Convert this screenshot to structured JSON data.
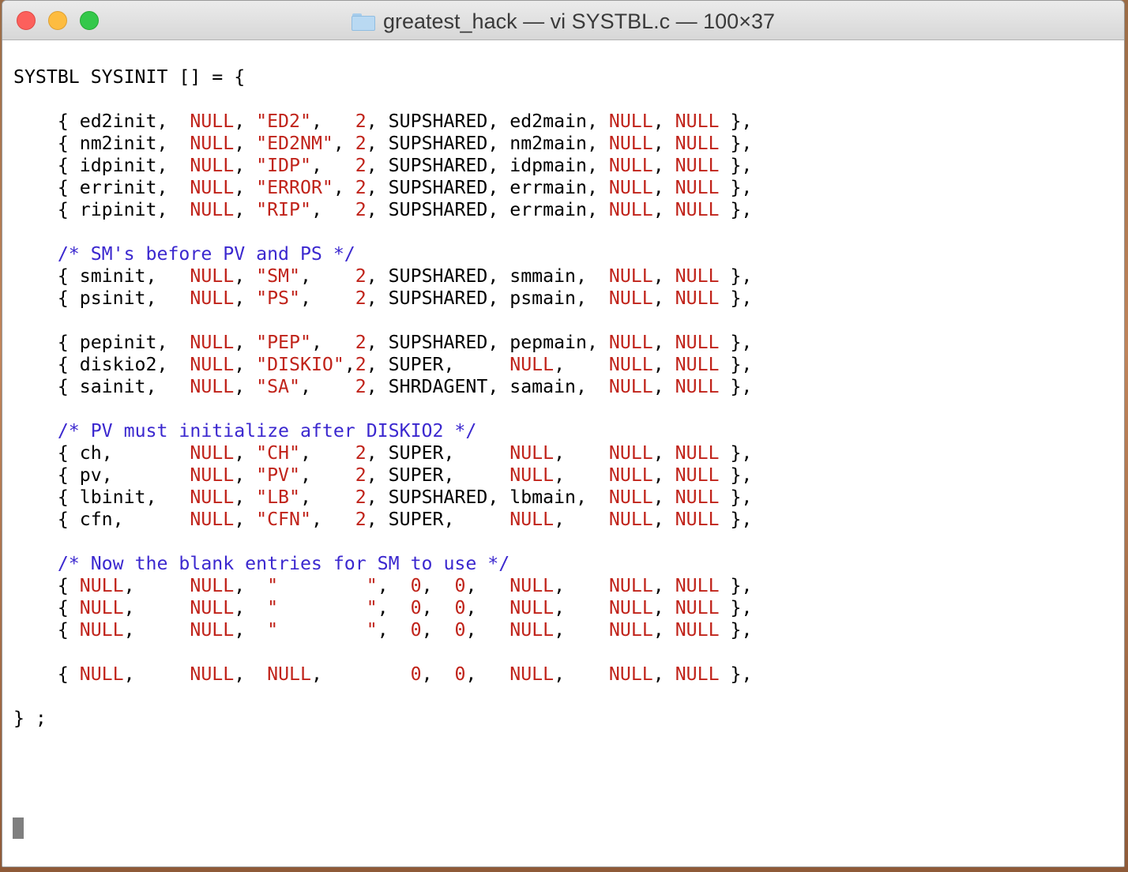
{
  "window": {
    "title": "greatest_hack — vi SYSTBL.c — 100×37",
    "folder_icon": "folder-icon"
  },
  "colors": {
    "keyword_red": "#c0231a",
    "comment_blue": "#3b28cf",
    "text": "#000000"
  },
  "code": {
    "lines": [
      [
        {
          "t": "SYSTBL SYSINIT [] = {",
          "c": ""
        }
      ],
      [
        {
          "t": "",
          "c": ""
        }
      ],
      [
        {
          "t": "    { ed2init,  ",
          "c": ""
        },
        {
          "t": "NULL",
          "c": "kw"
        },
        {
          "t": ", ",
          "c": ""
        },
        {
          "t": "\"ED2\"",
          "c": "kw"
        },
        {
          "t": ",   ",
          "c": ""
        },
        {
          "t": "2",
          "c": "kw"
        },
        {
          "t": ", SUPSHARED, ed2main, ",
          "c": ""
        },
        {
          "t": "NULL",
          "c": "kw"
        },
        {
          "t": ", ",
          "c": ""
        },
        {
          "t": "NULL",
          "c": "kw"
        },
        {
          "t": " },",
          "c": ""
        }
      ],
      [
        {
          "t": "    { nm2init,  ",
          "c": ""
        },
        {
          "t": "NULL",
          "c": "kw"
        },
        {
          "t": ", ",
          "c": ""
        },
        {
          "t": "\"ED2NM\"",
          "c": "kw"
        },
        {
          "t": ", ",
          "c": ""
        },
        {
          "t": "2",
          "c": "kw"
        },
        {
          "t": ", SUPSHARED, nm2main, ",
          "c": ""
        },
        {
          "t": "NULL",
          "c": "kw"
        },
        {
          "t": ", ",
          "c": ""
        },
        {
          "t": "NULL",
          "c": "kw"
        },
        {
          "t": " },",
          "c": ""
        }
      ],
      [
        {
          "t": "    { idpinit,  ",
          "c": ""
        },
        {
          "t": "NULL",
          "c": "kw"
        },
        {
          "t": ", ",
          "c": ""
        },
        {
          "t": "\"IDP\"",
          "c": "kw"
        },
        {
          "t": ",   ",
          "c": ""
        },
        {
          "t": "2",
          "c": "kw"
        },
        {
          "t": ", SUPSHARED, idpmain, ",
          "c": ""
        },
        {
          "t": "NULL",
          "c": "kw"
        },
        {
          "t": ", ",
          "c": ""
        },
        {
          "t": "NULL",
          "c": "kw"
        },
        {
          "t": " },",
          "c": ""
        }
      ],
      [
        {
          "t": "    { errinit,  ",
          "c": ""
        },
        {
          "t": "NULL",
          "c": "kw"
        },
        {
          "t": ", ",
          "c": ""
        },
        {
          "t": "\"ERROR\"",
          "c": "kw"
        },
        {
          "t": ", ",
          "c": ""
        },
        {
          "t": "2",
          "c": "kw"
        },
        {
          "t": ", SUPSHARED, errmain, ",
          "c": ""
        },
        {
          "t": "NULL",
          "c": "kw"
        },
        {
          "t": ", ",
          "c": ""
        },
        {
          "t": "NULL",
          "c": "kw"
        },
        {
          "t": " },",
          "c": ""
        }
      ],
      [
        {
          "t": "    { ripinit,  ",
          "c": ""
        },
        {
          "t": "NULL",
          "c": "kw"
        },
        {
          "t": ", ",
          "c": ""
        },
        {
          "t": "\"RIP\"",
          "c": "kw"
        },
        {
          "t": ",   ",
          "c": ""
        },
        {
          "t": "2",
          "c": "kw"
        },
        {
          "t": ", SUPSHARED, errmain, ",
          "c": ""
        },
        {
          "t": "NULL",
          "c": "kw"
        },
        {
          "t": ", ",
          "c": ""
        },
        {
          "t": "NULL",
          "c": "kw"
        },
        {
          "t": " },",
          "c": ""
        }
      ],
      [
        {
          "t": "",
          "c": ""
        }
      ],
      [
        {
          "t": "    ",
          "c": ""
        },
        {
          "t": "/* SM's before PV and PS */",
          "c": "cm"
        }
      ],
      [
        {
          "t": "    { sminit,   ",
          "c": ""
        },
        {
          "t": "NULL",
          "c": "kw"
        },
        {
          "t": ", ",
          "c": ""
        },
        {
          "t": "\"SM\"",
          "c": "kw"
        },
        {
          "t": ",    ",
          "c": ""
        },
        {
          "t": "2",
          "c": "kw"
        },
        {
          "t": ", SUPSHARED, smmain,  ",
          "c": ""
        },
        {
          "t": "NULL",
          "c": "kw"
        },
        {
          "t": ", ",
          "c": ""
        },
        {
          "t": "NULL",
          "c": "kw"
        },
        {
          "t": " },",
          "c": ""
        }
      ],
      [
        {
          "t": "    { psinit,   ",
          "c": ""
        },
        {
          "t": "NULL",
          "c": "kw"
        },
        {
          "t": ", ",
          "c": ""
        },
        {
          "t": "\"PS\"",
          "c": "kw"
        },
        {
          "t": ",    ",
          "c": ""
        },
        {
          "t": "2",
          "c": "kw"
        },
        {
          "t": ", SUPSHARED, psmain,  ",
          "c": ""
        },
        {
          "t": "NULL",
          "c": "kw"
        },
        {
          "t": ", ",
          "c": ""
        },
        {
          "t": "NULL",
          "c": "kw"
        },
        {
          "t": " },",
          "c": ""
        }
      ],
      [
        {
          "t": "",
          "c": ""
        }
      ],
      [
        {
          "t": "    { pepinit,  ",
          "c": ""
        },
        {
          "t": "NULL",
          "c": "kw"
        },
        {
          "t": ", ",
          "c": ""
        },
        {
          "t": "\"PEP\"",
          "c": "kw"
        },
        {
          "t": ",   ",
          "c": ""
        },
        {
          "t": "2",
          "c": "kw"
        },
        {
          "t": ", SUPSHARED, pepmain, ",
          "c": ""
        },
        {
          "t": "NULL",
          "c": "kw"
        },
        {
          "t": ", ",
          "c": ""
        },
        {
          "t": "NULL",
          "c": "kw"
        },
        {
          "t": " },",
          "c": ""
        }
      ],
      [
        {
          "t": "    { diskio2,  ",
          "c": ""
        },
        {
          "t": "NULL",
          "c": "kw"
        },
        {
          "t": ", ",
          "c": ""
        },
        {
          "t": "\"DISKIO\"",
          "c": "kw"
        },
        {
          "t": ",",
          "c": ""
        },
        {
          "t": "2",
          "c": "kw"
        },
        {
          "t": ", SUPER,     ",
          "c": ""
        },
        {
          "t": "NULL",
          "c": "kw"
        },
        {
          "t": ",    ",
          "c": ""
        },
        {
          "t": "NULL",
          "c": "kw"
        },
        {
          "t": ", ",
          "c": ""
        },
        {
          "t": "NULL",
          "c": "kw"
        },
        {
          "t": " },",
          "c": ""
        }
      ],
      [
        {
          "t": "    { sainit,   ",
          "c": ""
        },
        {
          "t": "NULL",
          "c": "kw"
        },
        {
          "t": ", ",
          "c": ""
        },
        {
          "t": "\"SA\"",
          "c": "kw"
        },
        {
          "t": ",    ",
          "c": ""
        },
        {
          "t": "2",
          "c": "kw"
        },
        {
          "t": ", SHRDAGENT, samain,  ",
          "c": ""
        },
        {
          "t": "NULL",
          "c": "kw"
        },
        {
          "t": ", ",
          "c": ""
        },
        {
          "t": "NULL",
          "c": "kw"
        },
        {
          "t": " },",
          "c": ""
        }
      ],
      [
        {
          "t": "",
          "c": ""
        }
      ],
      [
        {
          "t": "    ",
          "c": ""
        },
        {
          "t": "/* PV must initialize after DISKIO2 */",
          "c": "cm"
        }
      ],
      [
        {
          "t": "    { ch,       ",
          "c": ""
        },
        {
          "t": "NULL",
          "c": "kw"
        },
        {
          "t": ", ",
          "c": ""
        },
        {
          "t": "\"CH\"",
          "c": "kw"
        },
        {
          "t": ",    ",
          "c": ""
        },
        {
          "t": "2",
          "c": "kw"
        },
        {
          "t": ", SUPER,     ",
          "c": ""
        },
        {
          "t": "NULL",
          "c": "kw"
        },
        {
          "t": ",    ",
          "c": ""
        },
        {
          "t": "NULL",
          "c": "kw"
        },
        {
          "t": ", ",
          "c": ""
        },
        {
          "t": "NULL",
          "c": "kw"
        },
        {
          "t": " },",
          "c": ""
        }
      ],
      [
        {
          "t": "    { pv,       ",
          "c": ""
        },
        {
          "t": "NULL",
          "c": "kw"
        },
        {
          "t": ", ",
          "c": ""
        },
        {
          "t": "\"PV\"",
          "c": "kw"
        },
        {
          "t": ",    ",
          "c": ""
        },
        {
          "t": "2",
          "c": "kw"
        },
        {
          "t": ", SUPER,     ",
          "c": ""
        },
        {
          "t": "NULL",
          "c": "kw"
        },
        {
          "t": ",    ",
          "c": ""
        },
        {
          "t": "NULL",
          "c": "kw"
        },
        {
          "t": ", ",
          "c": ""
        },
        {
          "t": "NULL",
          "c": "kw"
        },
        {
          "t": " },",
          "c": ""
        }
      ],
      [
        {
          "t": "    { lbinit,   ",
          "c": ""
        },
        {
          "t": "NULL",
          "c": "kw"
        },
        {
          "t": ", ",
          "c": ""
        },
        {
          "t": "\"LB\"",
          "c": "kw"
        },
        {
          "t": ",    ",
          "c": ""
        },
        {
          "t": "2",
          "c": "kw"
        },
        {
          "t": ", SUPSHARED, lbmain,  ",
          "c": ""
        },
        {
          "t": "NULL",
          "c": "kw"
        },
        {
          "t": ", ",
          "c": ""
        },
        {
          "t": "NULL",
          "c": "kw"
        },
        {
          "t": " },",
          "c": ""
        }
      ],
      [
        {
          "t": "    { cfn,      ",
          "c": ""
        },
        {
          "t": "NULL",
          "c": "kw"
        },
        {
          "t": ", ",
          "c": ""
        },
        {
          "t": "\"CFN\"",
          "c": "kw"
        },
        {
          "t": ",   ",
          "c": ""
        },
        {
          "t": "2",
          "c": "kw"
        },
        {
          "t": ", SUPER,     ",
          "c": ""
        },
        {
          "t": "NULL",
          "c": "kw"
        },
        {
          "t": ",    ",
          "c": ""
        },
        {
          "t": "NULL",
          "c": "kw"
        },
        {
          "t": ", ",
          "c": ""
        },
        {
          "t": "NULL",
          "c": "kw"
        },
        {
          "t": " },",
          "c": ""
        }
      ],
      [
        {
          "t": "",
          "c": ""
        }
      ],
      [
        {
          "t": "    ",
          "c": ""
        },
        {
          "t": "/* Now the blank entries for SM to use */",
          "c": "cm"
        }
      ],
      [
        {
          "t": "    { ",
          "c": ""
        },
        {
          "t": "NULL",
          "c": "kw"
        },
        {
          "t": ",     ",
          "c": ""
        },
        {
          "t": "NULL",
          "c": "kw"
        },
        {
          "t": ",  ",
          "c": ""
        },
        {
          "t": "\"        \"",
          "c": "kw"
        },
        {
          "t": ",  ",
          "c": ""
        },
        {
          "t": "0",
          "c": "kw"
        },
        {
          "t": ",  ",
          "c": ""
        },
        {
          "t": "0",
          "c": "kw"
        },
        {
          "t": ",   ",
          "c": ""
        },
        {
          "t": "NULL",
          "c": "kw"
        },
        {
          "t": ",    ",
          "c": ""
        },
        {
          "t": "NULL",
          "c": "kw"
        },
        {
          "t": ", ",
          "c": ""
        },
        {
          "t": "NULL",
          "c": "kw"
        },
        {
          "t": " },",
          "c": ""
        }
      ],
      [
        {
          "t": "    { ",
          "c": ""
        },
        {
          "t": "NULL",
          "c": "kw"
        },
        {
          "t": ",     ",
          "c": ""
        },
        {
          "t": "NULL",
          "c": "kw"
        },
        {
          "t": ",  ",
          "c": ""
        },
        {
          "t": "\"        \"",
          "c": "kw"
        },
        {
          "t": ",  ",
          "c": ""
        },
        {
          "t": "0",
          "c": "kw"
        },
        {
          "t": ",  ",
          "c": ""
        },
        {
          "t": "0",
          "c": "kw"
        },
        {
          "t": ",   ",
          "c": ""
        },
        {
          "t": "NULL",
          "c": "kw"
        },
        {
          "t": ",    ",
          "c": ""
        },
        {
          "t": "NULL",
          "c": "kw"
        },
        {
          "t": ", ",
          "c": ""
        },
        {
          "t": "NULL",
          "c": "kw"
        },
        {
          "t": " },",
          "c": ""
        }
      ],
      [
        {
          "t": "    { ",
          "c": ""
        },
        {
          "t": "NULL",
          "c": "kw"
        },
        {
          "t": ",     ",
          "c": ""
        },
        {
          "t": "NULL",
          "c": "kw"
        },
        {
          "t": ",  ",
          "c": ""
        },
        {
          "t": "\"        \"",
          "c": "kw"
        },
        {
          "t": ",  ",
          "c": ""
        },
        {
          "t": "0",
          "c": "kw"
        },
        {
          "t": ",  ",
          "c": ""
        },
        {
          "t": "0",
          "c": "kw"
        },
        {
          "t": ",   ",
          "c": ""
        },
        {
          "t": "NULL",
          "c": "kw"
        },
        {
          "t": ",    ",
          "c": ""
        },
        {
          "t": "NULL",
          "c": "kw"
        },
        {
          "t": ", ",
          "c": ""
        },
        {
          "t": "NULL",
          "c": "kw"
        },
        {
          "t": " },",
          "c": ""
        }
      ],
      [
        {
          "t": "",
          "c": ""
        }
      ],
      [
        {
          "t": "    { ",
          "c": ""
        },
        {
          "t": "NULL",
          "c": "kw"
        },
        {
          "t": ",     ",
          "c": ""
        },
        {
          "t": "NULL",
          "c": "kw"
        },
        {
          "t": ",  ",
          "c": ""
        },
        {
          "t": "NULL",
          "c": "kw"
        },
        {
          "t": ",        ",
          "c": ""
        },
        {
          "t": "0",
          "c": "kw"
        },
        {
          "t": ",  ",
          "c": ""
        },
        {
          "t": "0",
          "c": "kw"
        },
        {
          "t": ",   ",
          "c": ""
        },
        {
          "t": "NULL",
          "c": "kw"
        },
        {
          "t": ",    ",
          "c": ""
        },
        {
          "t": "NULL",
          "c": "kw"
        },
        {
          "t": ", ",
          "c": ""
        },
        {
          "t": "NULL",
          "c": "kw"
        },
        {
          "t": " },",
          "c": ""
        }
      ],
      [
        {
          "t": "",
          "c": ""
        }
      ],
      [
        {
          "t": "} ;",
          "c": ""
        }
      ]
    ]
  }
}
